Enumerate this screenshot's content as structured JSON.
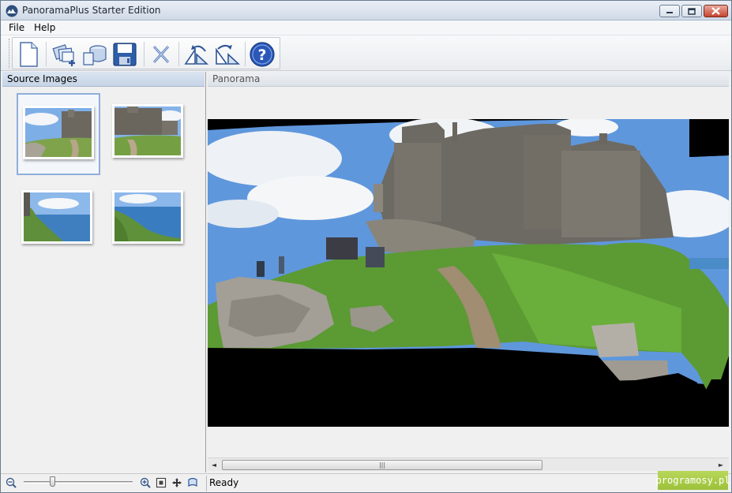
{
  "window": {
    "title": "PanoramaPlus Starter Edition",
    "controls": [
      "minimize-icon",
      "maximize-icon",
      "close-icon"
    ]
  },
  "menu": {
    "items": [
      {
        "label": "File"
      },
      {
        "label": "Help"
      }
    ]
  },
  "toolbar": {
    "buttons": [
      {
        "name": "new-project",
        "icon": "new-document-icon"
      },
      {
        "name": "add-images",
        "icon": "add-images-icon"
      },
      {
        "name": "open-project",
        "icon": "open-stack-icon"
      },
      {
        "name": "save",
        "icon": "floppy-disk-icon"
      },
      {
        "name": "remove",
        "icon": "remove-x-icon"
      },
      {
        "name": "rotate-left",
        "icon": "rotate-left-icon"
      },
      {
        "name": "rotate-right",
        "icon": "rotate-right-icon"
      },
      {
        "name": "help",
        "icon": "help-icon"
      }
    ]
  },
  "source_panel": {
    "title": "Source Images",
    "selected_index": 0,
    "thumbnails": [
      "castle-left",
      "castle-right",
      "coast-left",
      "coast-right"
    ]
  },
  "panorama_panel": {
    "title": "Panorama"
  },
  "statusbar": {
    "status": "Ready",
    "zoom_level": 0.25
  },
  "watermark": {
    "text": "programosy.pl"
  },
  "colors": {
    "selection_border": "#8faedb",
    "help_blue": "#2a57b8",
    "header_blue": "#c5d4e6"
  }
}
